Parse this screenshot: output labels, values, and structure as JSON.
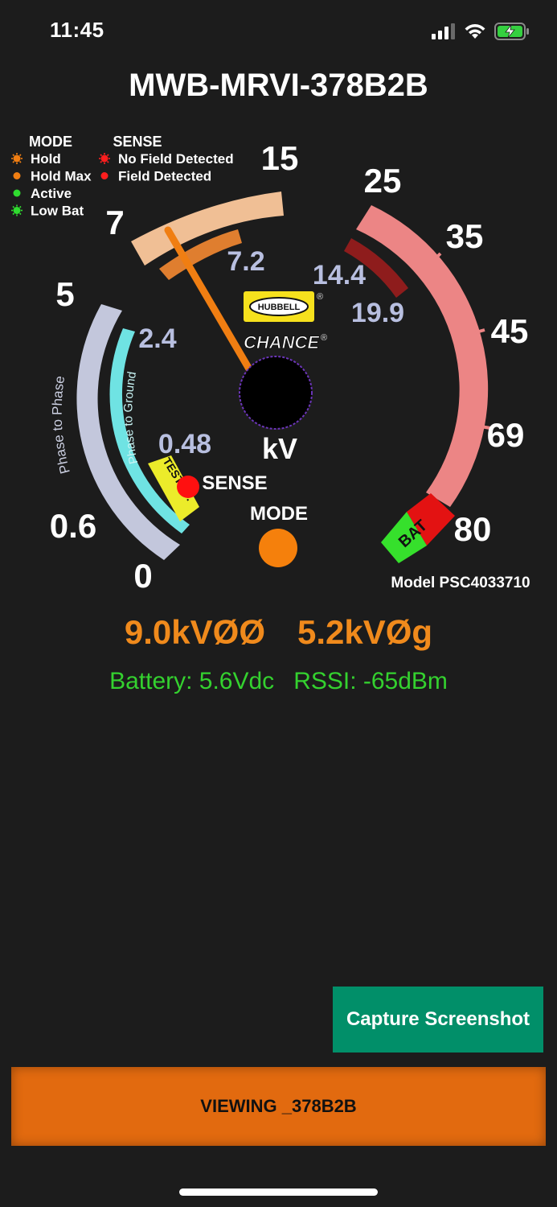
{
  "status_bar": {
    "time": "11:45",
    "signal_icon": "cellular-signal-icon",
    "wifi_icon": "wifi-icon",
    "battery_icon": "battery-charging-icon"
  },
  "device": {
    "title": "MWB-MRVI-378B2B"
  },
  "gauge": {
    "legend_mode": {
      "heading": "MODE",
      "items": [
        {
          "label": "Hold",
          "color": "#f07e12",
          "style": "blinking"
        },
        {
          "label": "Hold Max",
          "color": "#f07e12",
          "style": "solid"
        },
        {
          "label": "Active",
          "color": "#2fdc2f",
          "style": "solid"
        },
        {
          "label": "Low Bat",
          "color": "#2fdc2f",
          "style": "blinking"
        }
      ]
    },
    "legend_sense": {
      "heading": "SENSE",
      "items": [
        {
          "label": "No Field Detected",
          "color": "#ff1e1e",
          "style": "blinking"
        },
        {
          "label": "Field Detected",
          "color": "#ff1e1e",
          "style": "solid"
        }
      ]
    },
    "scale_labels": {
      "s15": "15",
      "s7": "7",
      "s7_2": "7.2",
      "s25": "25",
      "s35": "35",
      "s45": "45",
      "s69": "69",
      "s80": "80",
      "s14_4": "14.4",
      "s19_9": "19.9",
      "s5": "5",
      "s2_4": "2.4",
      "s0_48": "0.48",
      "s0_6": "0.6",
      "s0": "0"
    },
    "arc_labels": {
      "phase_to_phase": "Phase to Phase",
      "phase_to_ground": "Phase to Ground",
      "test_pt": "TEST PT.",
      "bat": "BAT"
    },
    "unit": "kV",
    "sense_label": "SENSE",
    "mode_label": "MODE",
    "brand_top": "HUBBELL",
    "brand_bottom": "CHANCE",
    "registered": "®",
    "model": "Model PSC4033710",
    "colors": {
      "low_outer": "#c3c7dc",
      "low_inner": "#6fe3e3",
      "test_pt": "#ecec2a",
      "mid_outer": "#f0bf95",
      "mid_inner": "#df7e2f",
      "high_outer": "#ec8585",
      "high_inner": "#8e1c1c",
      "bat_red": "#e31212",
      "bat_green": "#36e02c",
      "needle": "#f07e12",
      "sense_dot": "#ff1010",
      "mode_dot": "#f5800c"
    }
  },
  "readings": {
    "phase_phase": "9.0kVØØ",
    "phase_ground": "5.2kVØg"
  },
  "telemetry": {
    "battery": "Battery: 5.6Vdc",
    "rssi": "RSSI: -65dBm"
  },
  "buttons": {
    "capture": "Capture Screenshot",
    "viewing": "VIEWING _378B2B"
  }
}
